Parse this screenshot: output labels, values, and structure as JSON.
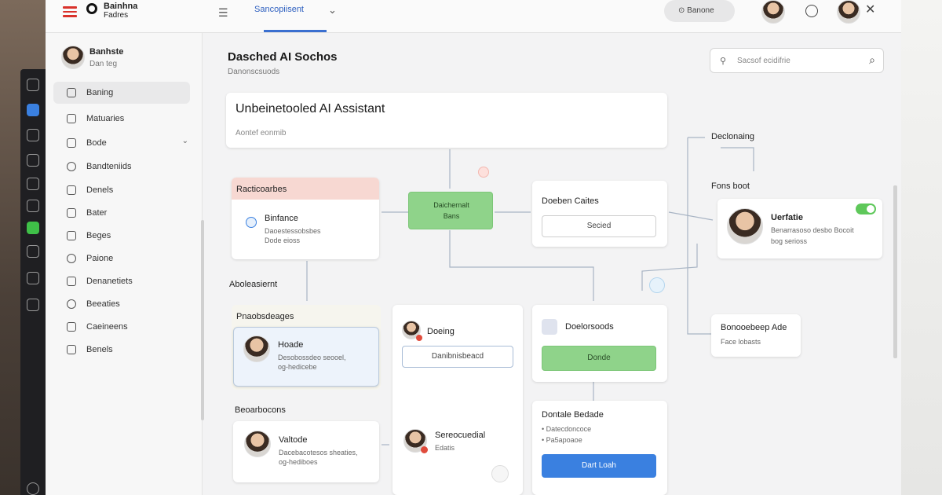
{
  "topbar": {
    "brand_line1": "Bainhna",
    "brand_line2": "Fadres",
    "tab_label": "Sancopiisent",
    "pill_label": "Banone",
    "close_label": "✕"
  },
  "sidebar": {
    "user_name": "Banhste",
    "user_sub": "Dan teg",
    "items": [
      {
        "label": "Baning",
        "active": true
      },
      {
        "label": "Matuaries"
      },
      {
        "label": "Bode",
        "chevron": "⌄"
      },
      {
        "label": "Bandteniids"
      },
      {
        "label": "Denels"
      },
      {
        "label": "Bater"
      },
      {
        "label": "Beges"
      },
      {
        "label": "Paione"
      },
      {
        "label": "Denanetiets"
      },
      {
        "label": "Beeaties"
      },
      {
        "label": "Caeineens"
      },
      {
        "label": "Benels"
      }
    ]
  },
  "main": {
    "title": "Dasched AI Sochos",
    "subtitle": "Danonscsuods",
    "search_placeholder": "Sacsof ecidifrie",
    "hero": {
      "title": "Unbeinetooled AI Assistant",
      "subtitle": "Aontef eonmib"
    },
    "sections": {
      "ranscoabes": "Racticoarbes",
      "aboleasiernt": "Aboleasiernt",
      "pnaesbdeages": "Pnaobsdeages",
      "beoarbocens": "Beoarbocons",
      "dectoning": "Declonaing",
      "fons_boot": "Fons boot"
    },
    "nodes": {
      "bind_card": {
        "title": "Binfance",
        "line1": "Daoestessobsbes",
        "line2": "Dode eioss"
      },
      "green_node": {
        "line1": "Daichernalt",
        "line2": "Bans"
      },
      "doebes": {
        "title": "Doeben Caites",
        "button": "Secied"
      },
      "person_right": {
        "title": "Uerfatie",
        "line1": "Benarrasoso desbo Bocoit",
        "line2": "bog serioss",
        "toggle_color": "#5ec85a"
      },
      "bloorbe": {
        "title": "Bonooebeep Ade",
        "line1": "Face lobasts"
      },
      "hoarde": {
        "title": "Hoade",
        "line1": "Desobossdeo seooel,",
        "line2": "og-hedicebe"
      },
      "daboxes": {
        "title": "Doeing",
        "input": "Danibnisbeacd"
      },
      "doclorends": {
        "title": "Doelorsoods",
        "button": "Donde"
      },
      "valtode": {
        "title": "Valtode",
        "line1": "Dacebacotesos sheaties,",
        "line2": "og-hediboes"
      },
      "seorsoodist": {
        "title": "Sereocuedial",
        "line1": "Edatis"
      },
      "pontale": {
        "title": "Dontale Bedade",
        "line1": "• Datecdoncoce",
        "line2": "• Pa5apoaoe",
        "button": "Dart Loah"
      }
    }
  },
  "colors": {
    "accent_blue": "#3a80e0",
    "green": "#8fd38a",
    "red": "#d9322b"
  }
}
